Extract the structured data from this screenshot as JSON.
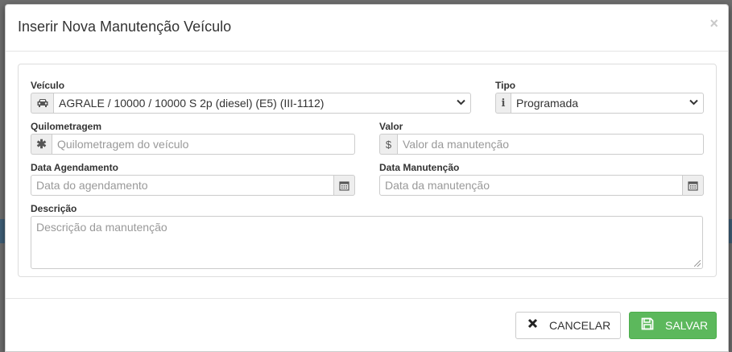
{
  "modal": {
    "title": "Inserir Nova Manutenção Veículo",
    "close": "×"
  },
  "form": {
    "veiculo": {
      "label": "Veículo",
      "icon": "car-icon",
      "value": "AGRALE / 10000 / 10000 S 2p (diesel) (E5) (III-1112)"
    },
    "tipo": {
      "label": "Tipo",
      "icon": "info-icon",
      "value": "Programada"
    },
    "quilometragem": {
      "label": "Quilometragem",
      "icon": "asterisk-icon",
      "placeholder": "Quilometragem do veículo"
    },
    "valor": {
      "label": "Valor",
      "icon": "dollar-icon",
      "placeholder": "Valor da manutenção"
    },
    "data_agendamento": {
      "label": "Data Agendamento",
      "icon": "calendar-icon",
      "placeholder": "Data do agendamento"
    },
    "data_manutencao": {
      "label": "Data Manutenção",
      "icon": "calendar-icon",
      "placeholder": "Data da manutenção"
    },
    "descricao": {
      "label": "Descrição",
      "placeholder": "Descrição da manutenção"
    }
  },
  "footer": {
    "cancel_label": "CANCELAR",
    "save_label": "SALVAR"
  },
  "colors": {
    "save_button": "#5cb85c",
    "addon_bg": "#eeeeee",
    "border": "#cccccc"
  }
}
